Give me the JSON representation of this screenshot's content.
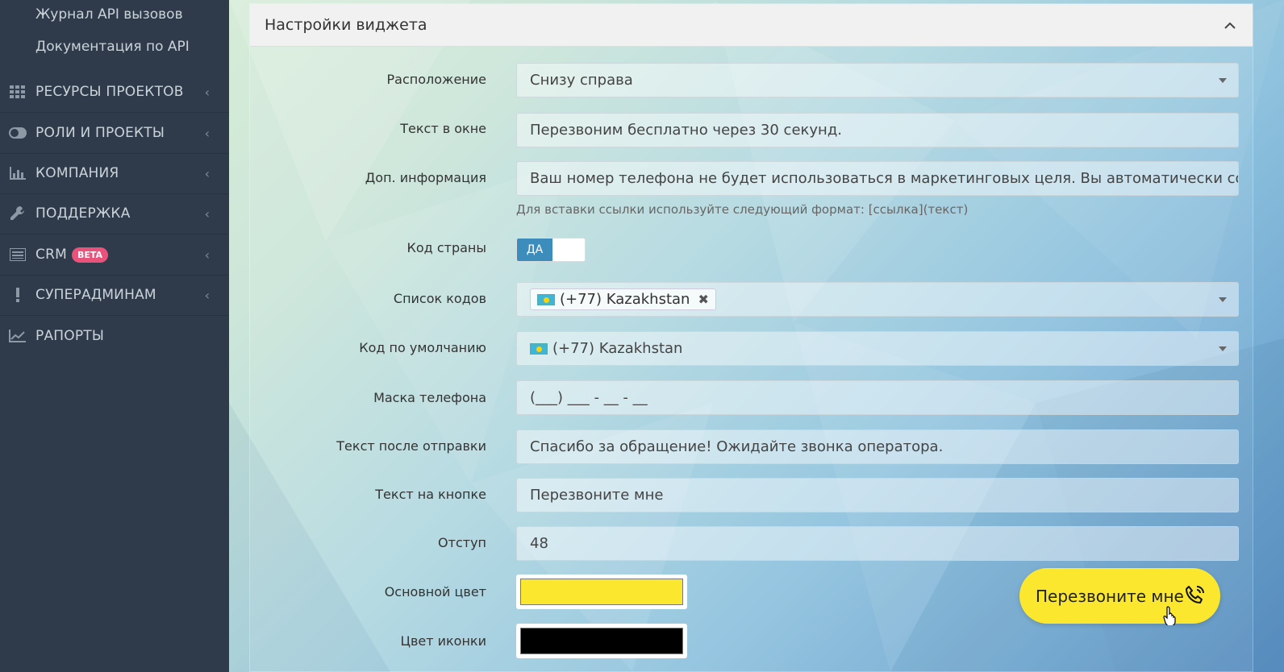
{
  "sidebar": {
    "sub_items": [
      {
        "label": "Журнал API вызовов"
      },
      {
        "label": "Документация по API"
      }
    ],
    "items": [
      {
        "label": "РЕСУРСЫ ПРОЕКТОВ",
        "icon": "grid-icon"
      },
      {
        "label": "РОЛИ И ПРОЕКТЫ",
        "icon": "toggle-icon"
      },
      {
        "label": "КОМПАНИЯ",
        "icon": "bar-chart-icon"
      },
      {
        "label": "ПОДДЕРЖКА",
        "icon": "wrench-icon"
      },
      {
        "label": "CRM",
        "icon": "list-icon",
        "badge": "BETA"
      },
      {
        "label": "СУПЕРАДМИНАМ",
        "icon": "exclamation-icon"
      },
      {
        "label": "РАПОРТЫ",
        "icon": "line-chart-icon"
      }
    ]
  },
  "panel": {
    "title": "Настройки виджета"
  },
  "form": {
    "position": {
      "label": "Расположение",
      "value": "Снизу справа"
    },
    "window_text": {
      "label": "Текст в окне",
      "value": "Перезвоним бесплатно через 30 секунд."
    },
    "extra_info": {
      "label": "Доп. информация",
      "value": "Ваш номер телефона не будет использоваться в маркетинговых целя. Вы автоматически соглашаетес",
      "help": "Для вставки ссылки используйте следующий формат: [ссылка](текст)"
    },
    "country_code": {
      "label": "Код страны",
      "toggle_on": "ДА",
      "value": true
    },
    "codes_list": {
      "label": "Список кодов",
      "tags": [
        "(+77) Kazakhstan"
      ]
    },
    "default_code": {
      "label": "Код по умолчанию",
      "value": "(+77) Kazakhstan"
    },
    "phone_mask": {
      "label": "Маска телефона",
      "value": "(___) ___ - __ - __"
    },
    "after_send_text": {
      "label": "Текст после отправки",
      "value": "Спасибо за обращение! Ожидайте звонка оператора."
    },
    "button_text": {
      "label": "Текст на кнопке",
      "value": "Перезвоните мне"
    },
    "offset": {
      "label": "Отступ",
      "value": "48"
    },
    "main_color": {
      "label": "Основной цвет",
      "value": "#fbe72e"
    },
    "icon_color": {
      "label": "Цвет иконки",
      "value": "#000000"
    }
  },
  "widget_preview": {
    "label": "Перезвоните мне",
    "color": "#fbe72e"
  }
}
